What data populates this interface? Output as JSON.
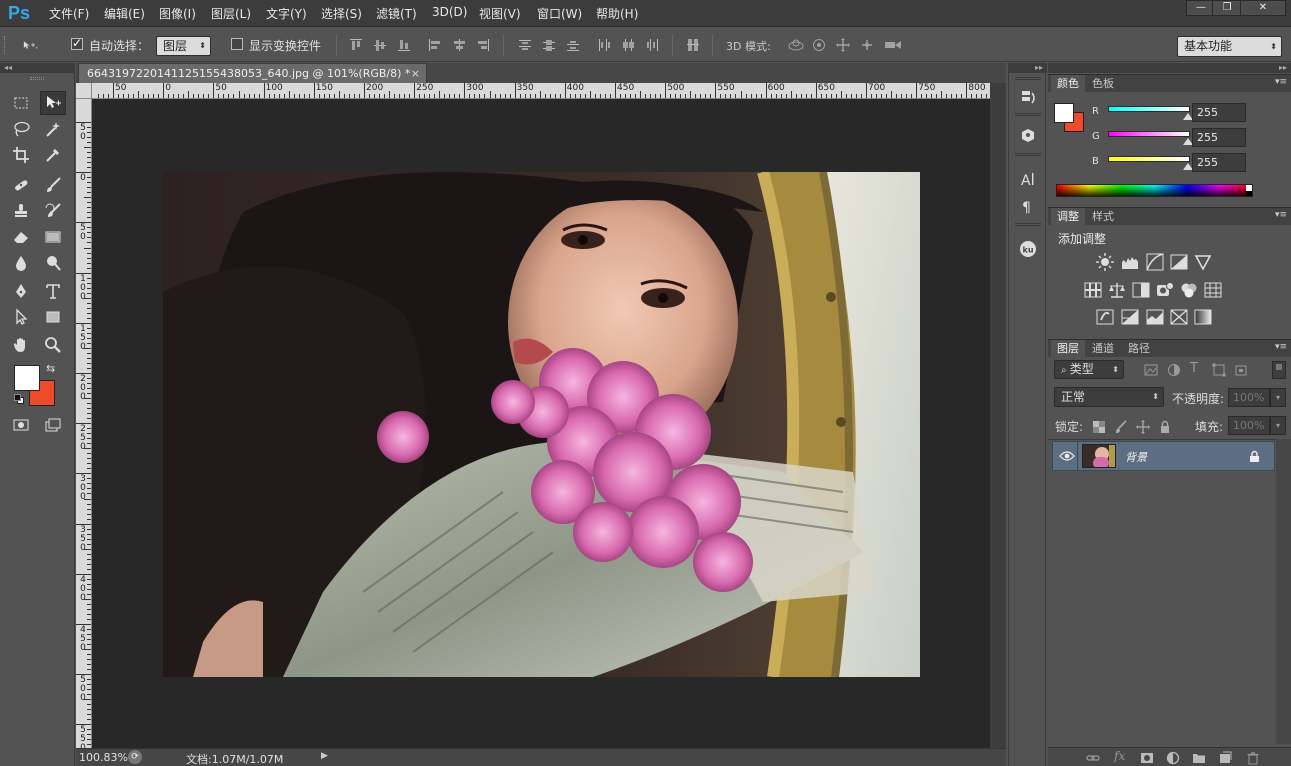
{
  "app": {
    "logo": "Ps",
    "menus": [
      "文件(F)",
      "编辑(E)",
      "图像(I)",
      "图层(L)",
      "文字(Y)",
      "选择(S)",
      "滤镜(T)",
      "3D(D)",
      "视图(V)",
      "窗口(W)",
      "帮助(H)"
    ],
    "window_buttons": [
      "—",
      "❐",
      "✕"
    ]
  },
  "options_bar": {
    "auto_select_label": "自动选择：",
    "auto_select_checked": true,
    "auto_select_target": "图层",
    "show_transform_label": "显示变换控件",
    "show_transform_checked": false,
    "mode_3d_label": "3D 模式:",
    "workspace": "基本功能"
  },
  "document": {
    "tab_title": "664319722014112515543 8053_640.jpg @ 101%(RGB/8) *",
    "tab_close": "×",
    "ruler_h_labels": [
      "50",
      "0",
      "50",
      "100",
      "150",
      "200",
      "250",
      "300",
      "350",
      "400",
      "450",
      "500",
      "550",
      "600",
      "650",
      "700",
      "750",
      "800"
    ],
    "ruler_v_labels": [
      "5\n0",
      "0",
      "5\n0",
      "1\n0\n0",
      "1\n5\n0",
      "2\n0\n0",
      "2\n5\n0",
      "3\n0\n0",
      "3\n5\n0",
      "4\n0\n0",
      "4\n5\n0",
      "5\n0\n0",
      "5\n5\n0"
    ],
    "zoom": "100.83%",
    "doc_info": "文档:1.07M/1.07M"
  },
  "color_panel": {
    "tabs": [
      "颜色",
      "色板"
    ],
    "active_tab": "颜色",
    "foreground": "#ffffff",
    "background": "#f04a2c",
    "channels": [
      {
        "name": "R",
        "value": "255",
        "gradient": "linear-gradient(to right,#00ffff,#ffffff)"
      },
      {
        "name": "G",
        "value": "255",
        "gradient": "linear-gradient(to right,#ff00ff,#ffffff)"
      },
      {
        "name": "B",
        "value": "255",
        "gradient": "linear-gradient(to right,#ffff00,#ffffff)"
      }
    ]
  },
  "adjust_panel": {
    "tabs": [
      "调整",
      "样式"
    ],
    "active_tab": "调整",
    "title": "添加调整"
  },
  "layers_panel": {
    "tabs": [
      "图层",
      "通道",
      "路径"
    ],
    "active_tab": "图层",
    "filter_kind": "类型",
    "blend_mode": "正常",
    "opacity_label": "不透明度:",
    "opacity_value": "100%",
    "lock_label": "锁定:",
    "fill_label": "填充:",
    "fill_value": "100%",
    "layers": [
      {
        "name": "背景",
        "visible": true,
        "locked": true
      }
    ]
  },
  "toolbox": {
    "foreground": "#ffffff",
    "background": "#f04a2c"
  }
}
